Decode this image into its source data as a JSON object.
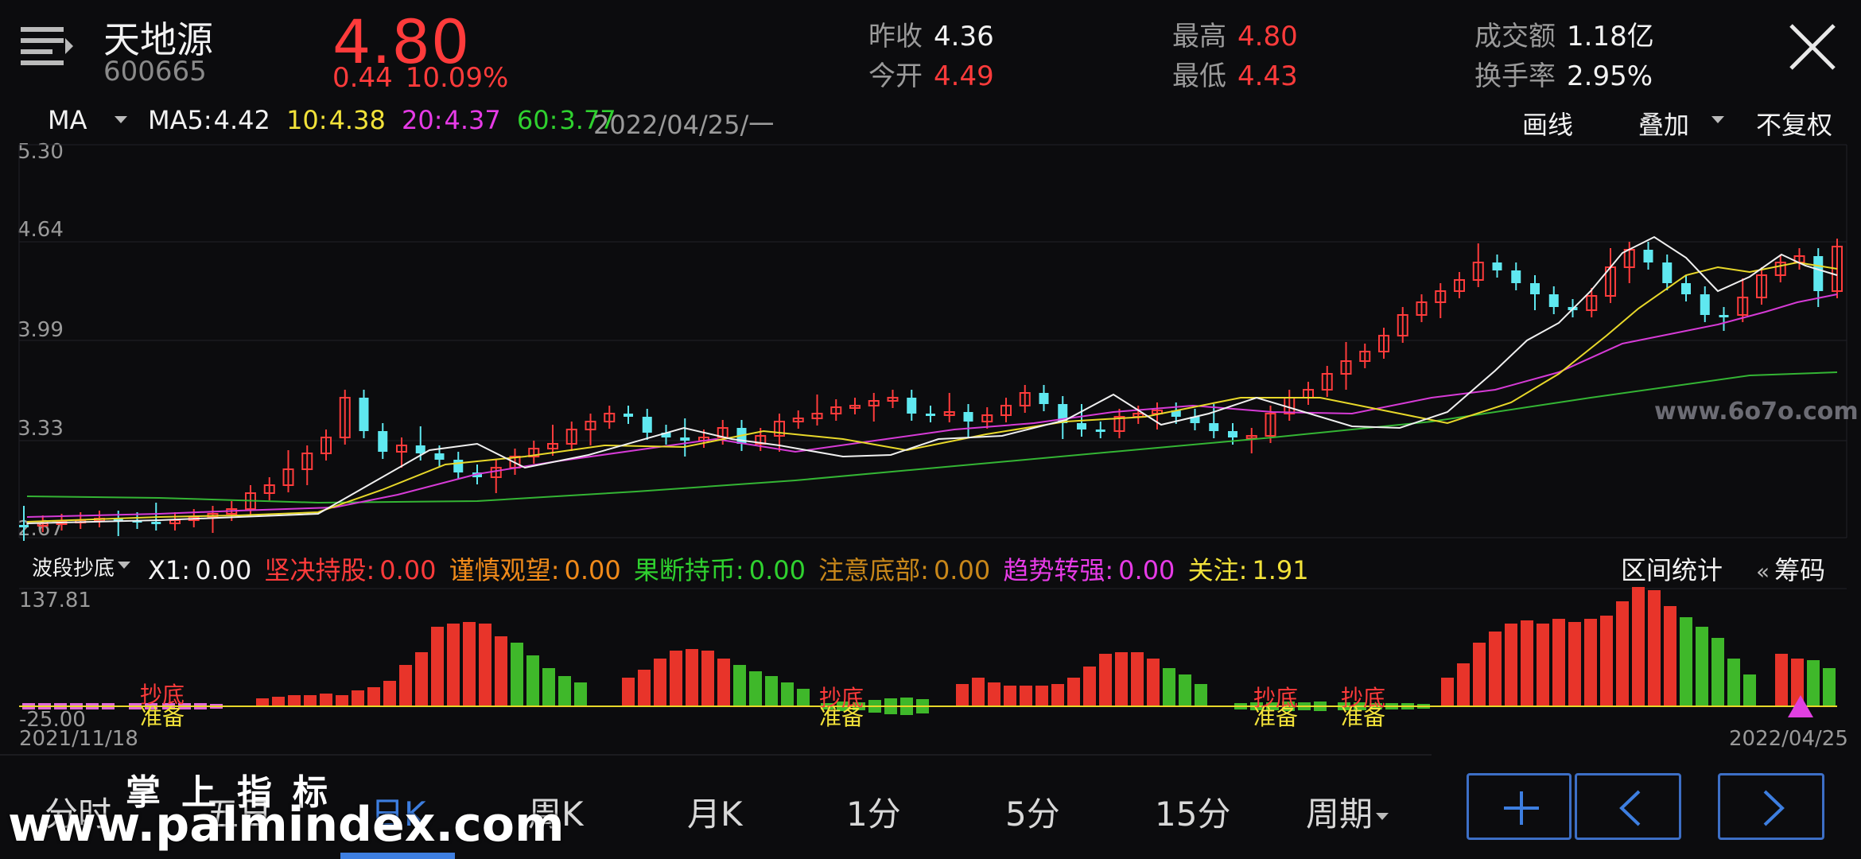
{
  "header": {
    "name": "天地源",
    "code": "600665",
    "price": "4.80",
    "change": "0.44",
    "change_pct": "10.09%",
    "stats": [
      {
        "label": "昨收",
        "value": "4.36",
        "color": "#f2f2f2"
      },
      {
        "label": "今开",
        "value": "4.49",
        "color": "#ff3b3b"
      },
      {
        "label": "最高",
        "value": "4.80",
        "color": "#ff3b3b"
      },
      {
        "label": "最低",
        "value": "4.43",
        "color": "#ff3b3b"
      },
      {
        "label": "成交额",
        "value": "1.18亿",
        "color": "#f2f2f2"
      },
      {
        "label": "换手率",
        "value": "2.95%",
        "color": "#f2f2f2"
      }
    ]
  },
  "ma_bar": {
    "selector": "MA",
    "ma5_label": "MA5:",
    "ma5_value": "4.42",
    "ma10_label": "10:",
    "ma10_value": "4.38",
    "ma20_label": "20:",
    "ma20_value": "4.37",
    "ma60_label": "60:",
    "ma60_value": "3.77",
    "date": "2022/04/25/一",
    "draw_label": "画线",
    "overlay_label": "叠加",
    "adjust_label": "不复权"
  },
  "main_axis": {
    "ticks": [
      "5.30",
      "4.64",
      "3.99",
      "3.33",
      "2.67"
    ]
  },
  "sub_bar": {
    "selector": "波段抄底",
    "items": [
      {
        "label": "X1:",
        "value": "0.00",
        "color": "#f2f2f2"
      },
      {
        "label": "坚决持股:",
        "value": "0.00",
        "color": "#ff3b3b"
      },
      {
        "label": "谨慎观望:",
        "value": "0.00",
        "color": "#f08a1a"
      },
      {
        "label": "果断持币:",
        "value": "0.00",
        "color": "#2fd12f"
      },
      {
        "label": "注意底部:",
        "value": "0.00",
        "color": "#c8871a"
      },
      {
        "label": "趋势转强:",
        "value": "0.00",
        "color": "#e63be6"
      },
      {
        "label": "关注:",
        "value": "1.91",
        "color": "#f2e23a"
      }
    ],
    "range_stats": "区间统计",
    "chips": "筹码",
    "chips_icon": "double-chevron-left-icon"
  },
  "sub_axis": {
    "top": "137.81",
    "bottom": "-25.00"
  },
  "sub_labels": {
    "bottom_text": "抄底",
    "ready_text": "准备"
  },
  "dates": {
    "start": "2021/11/18",
    "end": "2022/04/25"
  },
  "tabs": [
    "分时",
    "五日",
    "日K",
    "周K",
    "月K",
    "1分",
    "5分",
    "15分",
    "周期"
  ],
  "active_tab": "日K",
  "watermarks": {
    "top": "掌上指标",
    "url": "www.palmindex.com",
    "site": "www.6o7o.com"
  },
  "icons": {
    "menu": "menu-icon",
    "close": "close-icon",
    "add": "plus-icon",
    "prev": "chevron-left-icon",
    "next": "chevron-right-icon"
  }
}
